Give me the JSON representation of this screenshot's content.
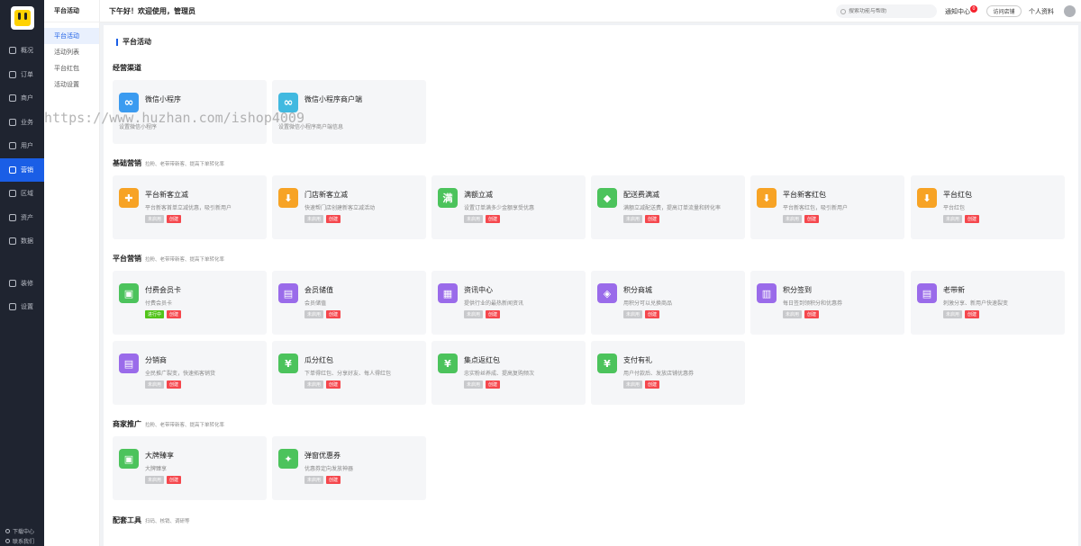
{
  "sidebar": {
    "items": [
      {
        "label": "概况"
      },
      {
        "label": "订单"
      },
      {
        "label": "商户"
      },
      {
        "label": "业务"
      },
      {
        "label": "用户"
      },
      {
        "label": "营销"
      },
      {
        "label": "区域"
      },
      {
        "label": "资产"
      },
      {
        "label": "数据"
      },
      {
        "label": "装修"
      },
      {
        "label": "设置"
      }
    ],
    "download": "下载中心",
    "contact": "联系我们"
  },
  "subnav": {
    "title": "平台活动",
    "items": [
      {
        "label": "平台活动"
      },
      {
        "label": "活动列表"
      },
      {
        "label": "平台红包"
      },
      {
        "label": "活动设置"
      }
    ]
  },
  "header": {
    "greeting": "下午好！欢迎使用，管理员",
    "search_placeholder": "搜索功能与帮助",
    "notify": "通知中心",
    "notify_count": "0",
    "visit_store": "访问店铺",
    "profile": "个人资料"
  },
  "page_title": "平台活动",
  "sections": {
    "channels": {
      "title": "经营渠道",
      "note": ""
    },
    "basic": {
      "title": "基础营销",
      "note": "拉粉、老带带新客、提高下单转化率"
    },
    "platform": {
      "title": "平台营销",
      "note": "拉粉、老带带新客、提高下单转化率"
    },
    "merchant": {
      "title": "商家推广",
      "note": "拉粉、老带带新客、提高下单转化率"
    },
    "tools": {
      "title": "配套工具",
      "note": "扫码、核销、调研等"
    }
  },
  "channels": [
    {
      "name": "微信小程序",
      "desc": "设置微信小程序",
      "color": "#3b9bf0"
    },
    {
      "name": "微信小程序商户端",
      "desc": "设置微信小程序商户端信息",
      "color": "#41b9e0"
    }
  ],
  "basic": [
    {
      "name": "平台新客立减",
      "desc": "平台新客首单立减优惠，吸引新用户",
      "status": "未启用",
      "action": "创建",
      "color": "#f7a325",
      "glyph": "✚"
    },
    {
      "name": "门店新客立减",
      "desc": "快速帮门店创建新客立减活动",
      "status": "未启用",
      "action": "创建",
      "color": "#f7a325",
      "glyph": "⬇"
    },
    {
      "name": "满额立减",
      "desc": "设置订单满多少金额享受优惠",
      "status": "未启用",
      "action": "创建",
      "color": "#4cc35c",
      "glyph": "满"
    },
    {
      "name": "配送费满减",
      "desc": "满额立减配送费，提高订单流量和转化率",
      "status": "未启用",
      "action": "创建",
      "color": "#4cc35c",
      "glyph": "◆"
    },
    {
      "name": "平台新客红包",
      "desc": "平台新客红包，吸引新用户",
      "status": "未启用",
      "action": "创建",
      "color": "#f7a325",
      "glyph": "⬇"
    },
    {
      "name": "平台红包",
      "desc": "平台红包",
      "status": "未启用",
      "action": "创建",
      "color": "#f7a325",
      "glyph": "⬇"
    }
  ],
  "platform": [
    {
      "name": "付费会员卡",
      "desc": "付费会员卡",
      "status": "进行中",
      "action": "创建",
      "color": "#4cc35c",
      "glyph": "▣",
      "active": true
    },
    {
      "name": "会员储值",
      "desc": "会员储值",
      "status": "未启用",
      "action": "创建",
      "color": "#9a6bea",
      "glyph": "▤"
    },
    {
      "name": "资讯中心",
      "desc": "提供行业的最热新闻资讯",
      "status": "未启用",
      "action": "创建",
      "color": "#9a6bea",
      "glyph": "▦"
    },
    {
      "name": "积分商城",
      "desc": "用积分可以兑换商品",
      "status": "未启用",
      "action": "创建",
      "color": "#9a6bea",
      "glyph": "◈"
    },
    {
      "name": "积分签到",
      "desc": "每日签到领积分和优惠券",
      "status": "未启用",
      "action": "创建",
      "color": "#9a6bea",
      "glyph": "▥"
    },
    {
      "name": "老带新",
      "desc": "刺激分享、新用户快速裂变",
      "status": "未启用",
      "action": "创建",
      "color": "#9a6bea",
      "glyph": "▤"
    },
    {
      "name": "分销商",
      "desc": "全民推广裂变，快速拓客销货",
      "status": "未启用",
      "action": "创建",
      "color": "#9a6bea",
      "glyph": "▤"
    },
    {
      "name": "瓜分红包",
      "desc": "下单得红包、分享好友、每人得红包",
      "status": "未启用",
      "action": "创建",
      "color": "#4cc35c",
      "glyph": "¥"
    },
    {
      "name": "集点返红包",
      "desc": "忠实粉丝养成、提高复购频次",
      "status": "未启用",
      "action": "创建",
      "color": "#4cc35c",
      "glyph": "¥"
    },
    {
      "name": "支付有礼",
      "desc": "用户付款后、发放店铺优惠券",
      "status": "未启用",
      "action": "创建",
      "color": "#4cc35c",
      "glyph": "¥"
    }
  ],
  "merchant": [
    {
      "name": "大牌臻享",
      "desc": "大牌臻享",
      "status": "未启用",
      "action": "创建",
      "color": "#4cc35c",
      "glyph": "▣"
    },
    {
      "name": "弹窗优惠券",
      "desc": "优惠券定向发放神器",
      "status": "未启用",
      "action": "创建",
      "color": "#4cc35c",
      "glyph": "✦"
    }
  ],
  "watermark": "https://www.huzhan.com/ishop4009"
}
